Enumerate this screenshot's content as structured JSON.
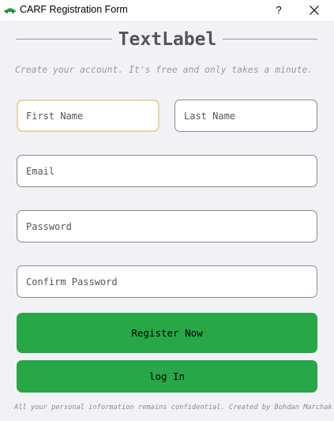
{
  "window": {
    "title": "CARF Registration Form",
    "icon": "car-icon",
    "help_label": "?",
    "close_icon": "close-icon"
  },
  "form": {
    "heading": "TextLabel",
    "subtitle": "Create your account. It's free and only takes a minute.",
    "first_name": {
      "placeholder": "First Name",
      "value": ""
    },
    "last_name": {
      "placeholder": "Last Name",
      "value": ""
    },
    "email": {
      "placeholder": "Email",
      "value": ""
    },
    "password": {
      "placeholder": "Password",
      "value": ""
    },
    "confirm_password": {
      "placeholder": "Confirm Password",
      "value": ""
    },
    "register_label": "Register Now",
    "login_label": "log In",
    "footer": "All your personal information remains confidential. Created by Bohdan Marchak"
  },
  "colors": {
    "background": "#f2f2f6",
    "button": "#27a746",
    "focus_border": "#e8d3a8",
    "icon_green": "#1f9e3a"
  }
}
